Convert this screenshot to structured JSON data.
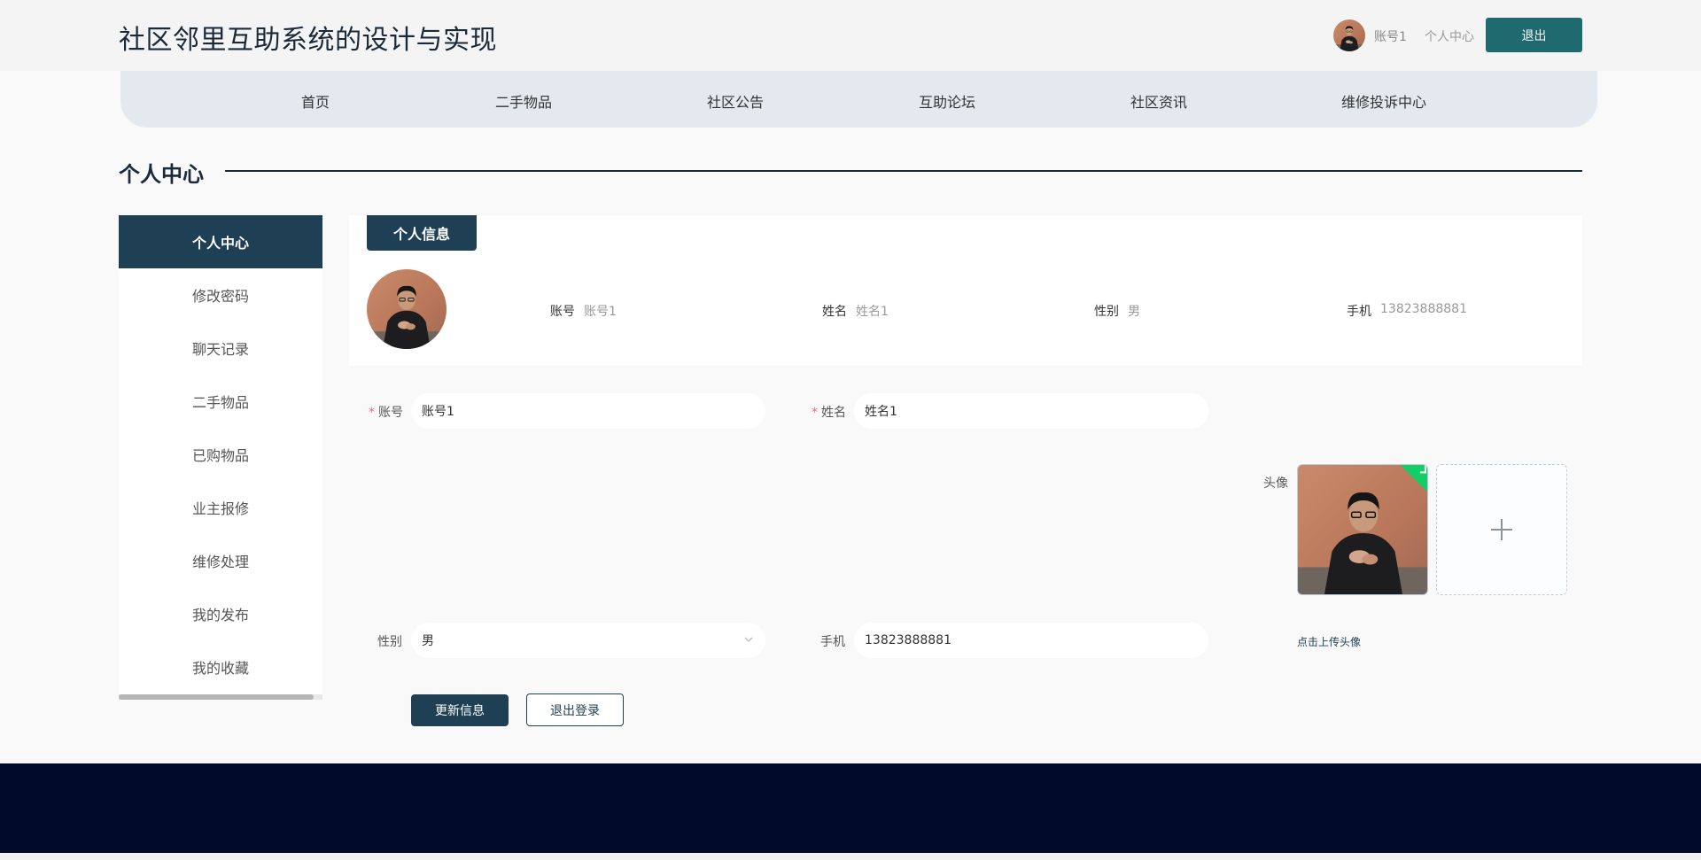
{
  "header": {
    "site_title": "社区邻里互助系统的设计与实现",
    "user_name": "账号1",
    "user_center": "个人中心",
    "logout": "退出"
  },
  "nav": {
    "items": [
      "首页",
      "二手物品",
      "社区公告",
      "互助论坛",
      "社区资讯",
      "维修投诉中心"
    ]
  },
  "page": {
    "section_title": "个人中心"
  },
  "sidebar": {
    "items": [
      "个人中心",
      "修改密码",
      "聊天记录",
      "二手物品",
      "已购物品",
      "业主报修",
      "维修处理",
      "我的发布",
      "我的收藏"
    ],
    "active_index": 0
  },
  "info_card": {
    "tab": "个人信息",
    "account_label": "账号",
    "account_value": "账号1",
    "name_label": "姓名",
    "name_value": "姓名1",
    "gender_label": "性别",
    "gender_value": "男",
    "phone_label": "手机",
    "phone_value": "13823888881"
  },
  "form": {
    "required_mark": "*",
    "account_label": "账号",
    "account_value": "账号1",
    "name_label": "姓名",
    "name_value": "姓名1",
    "avatar_label": "头像",
    "gender_label": "性别",
    "gender_value": "男",
    "phone_label": "手机",
    "phone_value": "13823888881",
    "upload_tip": "点击上传头像",
    "update_button": "更新信息",
    "logout_button": "退出登录"
  },
  "colors": {
    "primary": "#1f3f55",
    "teal": "#1f6a6e",
    "footer": "#000b2a",
    "success": "#13ce66"
  }
}
